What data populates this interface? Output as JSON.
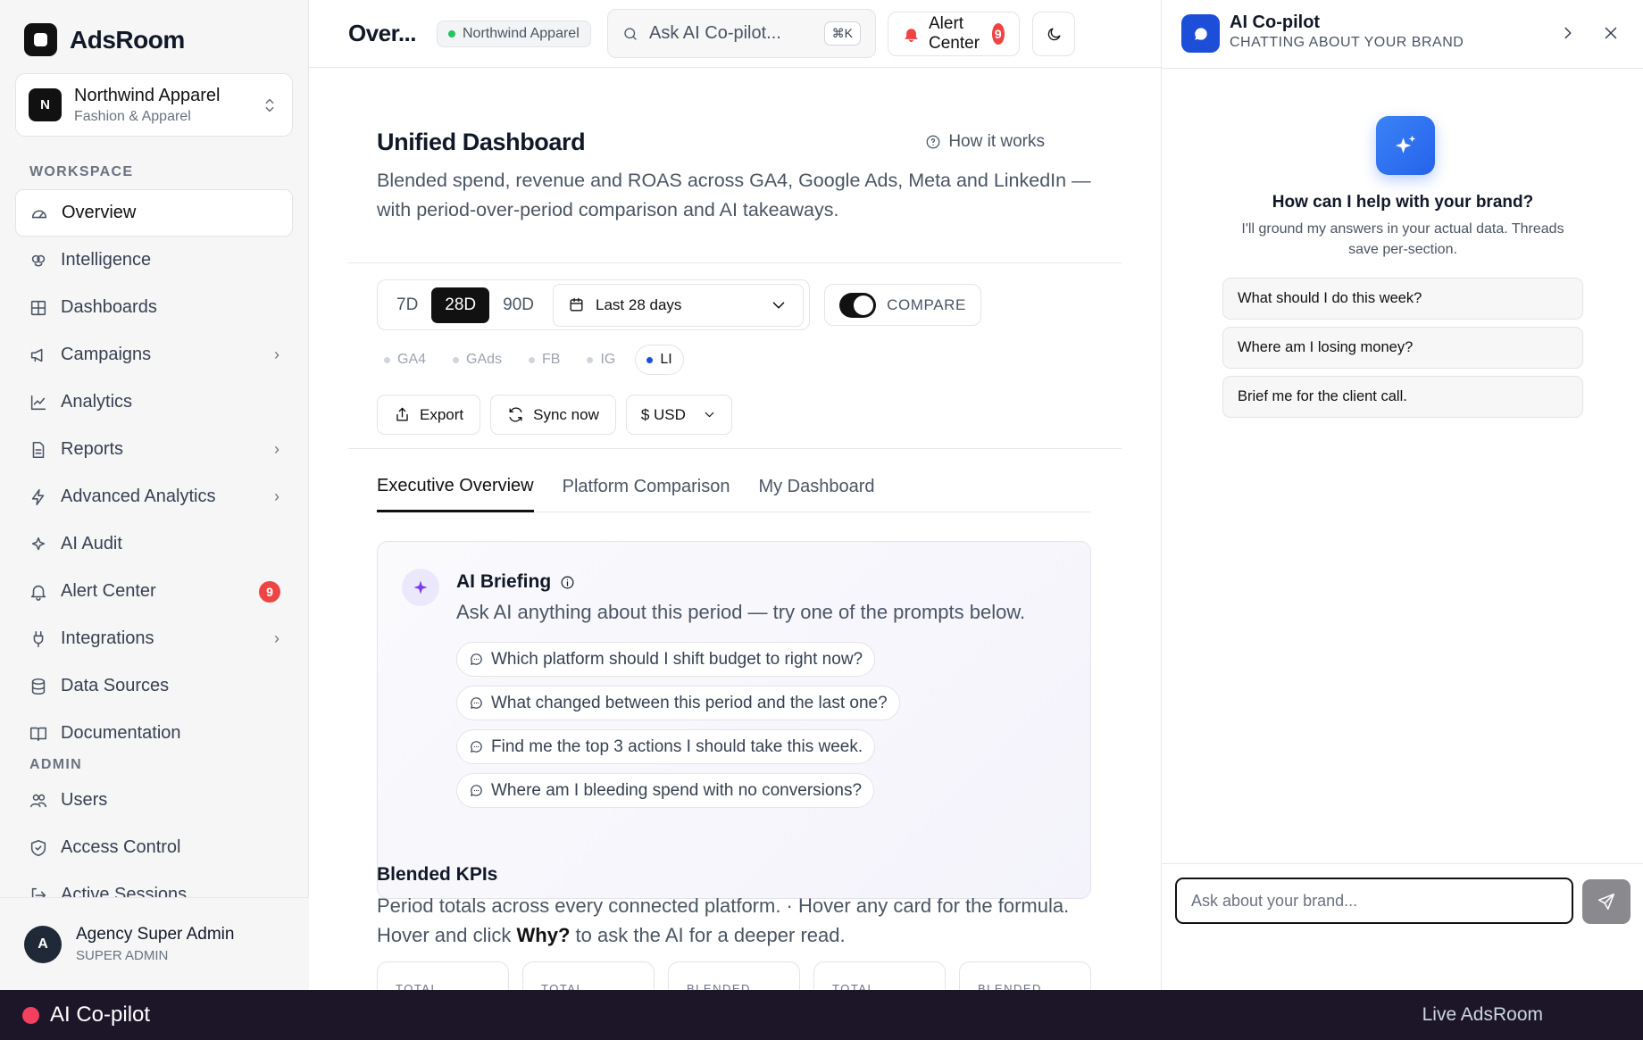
{
  "app": {
    "name": "AdsRoom"
  },
  "brand": {
    "avatar": "N",
    "name": "Northwind Apparel",
    "category": "Fashion & Apparel"
  },
  "sidebar": {
    "workspace_label": "WORKSPACE",
    "items": [
      {
        "label": "Overview",
        "icon": "gauge-icon"
      },
      {
        "label": "Intelligence",
        "icon": "brain-icon"
      },
      {
        "label": "Dashboards",
        "icon": "grid-icon"
      },
      {
        "label": "Campaigns",
        "icon": "megaphone-icon"
      },
      {
        "label": "Analytics",
        "icon": "chart-line-icon"
      },
      {
        "label": "Reports",
        "icon": "document-icon"
      },
      {
        "label": "Advanced Analytics",
        "icon": "bolt-icon"
      },
      {
        "label": "AI Audit",
        "icon": "sparkles-icon"
      },
      {
        "label": "Alert Center",
        "icon": "bell-icon",
        "badge": "9"
      },
      {
        "label": "Integrations",
        "icon": "plug-icon"
      },
      {
        "label": "Data Sources",
        "icon": "database-icon"
      },
      {
        "label": "Documentation",
        "icon": "book-icon"
      }
    ],
    "admin_label": "ADMIN",
    "admin_items": [
      {
        "label": "Users",
        "icon": "users-icon"
      },
      {
        "label": "Access Control",
        "icon": "shield-icon"
      },
      {
        "label": "Active Sessions",
        "icon": "logout-icon"
      }
    ]
  },
  "user": {
    "avatar": "A",
    "name": "Agency Super Admin",
    "role": "SUPER ADMIN"
  },
  "topbar": {
    "page_short": "Over...",
    "brand_pill": "Northwind Apparel",
    "ask_placeholder": "Ask AI Co-pilot...",
    "shortcut": "⌘K",
    "alert_label": "Alert Center",
    "alert_count": "9"
  },
  "main": {
    "title": "Unified Dashboard",
    "how_it_works": "How it works",
    "subtitle": "Blended spend, revenue and ROAS across GA4, Google Ads, Meta and LinkedIn — with period-over-period comparison and AI takeaways.",
    "ranges": [
      "7D",
      "28D",
      "90D"
    ],
    "selected_range": "28D",
    "date_range": "Last 28 days",
    "compare_label": "COMPARE",
    "compare_on": true,
    "platforms": [
      {
        "label": "GA4",
        "active": false
      },
      {
        "label": "GAds",
        "active": false
      },
      {
        "label": "FB",
        "active": false
      },
      {
        "label": "IG",
        "active": false
      },
      {
        "label": "LI",
        "active": true
      }
    ],
    "export_label": "Export",
    "sync_label": "Sync now",
    "currency_label": "$ USD",
    "tabs": [
      "Executive Overview",
      "Platform Comparison",
      "My Dashboard"
    ],
    "active_tab": "Executive Overview",
    "briefing": {
      "title": "AI Briefing",
      "subtitle": "Ask AI anything about this period — try one of the prompts below.",
      "prompts": [
        "Which platform should I shift budget to right now?",
        "What changed between this period and the last one?",
        "Find me the top 3 actions I should take this week.",
        "Where am I bleeding spend with no conversions?"
      ]
    },
    "kpis": {
      "title": "Blended KPIs",
      "subtitle_a": "Period totals across every connected platform. · Hover any card for the formula. Hover and click",
      "subtitle_why": "Why?",
      "subtitle_b": "to ask the AI for a deeper read.",
      "cards": [
        "TOTAL",
        "TOTAL",
        "BLENDED",
        "TOTAL",
        "BLENDED"
      ]
    }
  },
  "copilot": {
    "title": "AI Co-pilot",
    "subtitle": "CHATTING ABOUT YOUR BRAND",
    "question": "How can I help with your brand?",
    "description": "I'll ground my answers in your actual data. Threads save per-section.",
    "suggestions": [
      "What should I do this week?",
      "Where am I losing money?",
      "Brief me for the client call."
    ],
    "input_placeholder": "Ask about your brand..."
  },
  "bottombar": {
    "label": "AI Co-pilot",
    "right": "Live AdsRoom"
  },
  "colors": {
    "accent": "#1d4ed8",
    "alert": "#ef4444",
    "bottombar": "#1d1629",
    "dot_live": "#f43f5e"
  }
}
